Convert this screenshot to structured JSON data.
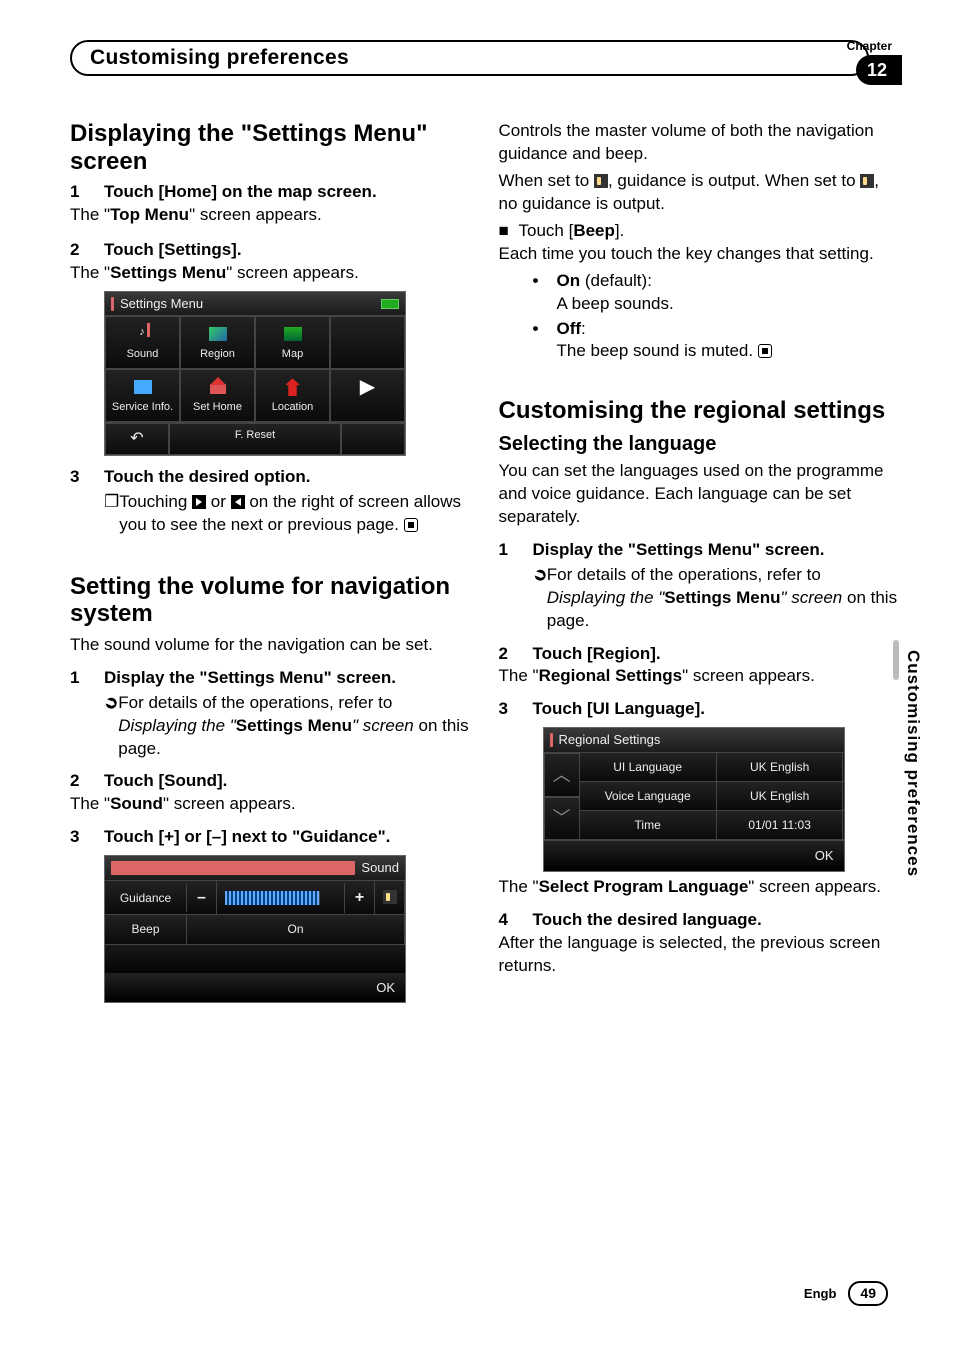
{
  "chapter_label": "Chapter",
  "chapter_number": "12",
  "header_title": "Customising preferences",
  "side_tab": "Customising preferences",
  "footer_lang": "Engb",
  "footer_page": "49",
  "left": {
    "h2_a": "Displaying the \"Settings Menu\" screen",
    "s1_num": "1",
    "s1_label": "Touch [Home] on the map screen.",
    "s1_p_a": "The \"",
    "s1_p_b": "Top Menu",
    "s1_p_c": "\" screen appears.",
    "s2_num": "2",
    "s2_label": "Touch [Settings].",
    "s2_p_a": "The \"",
    "s2_p_b": "Settings Menu",
    "s2_p_c": "\" screen appears.",
    "ss_title": "Settings Menu",
    "ss_items": [
      "Sound",
      "Region",
      "Map",
      "",
      "Service Info.",
      "Set Home",
      "Location",
      ""
    ],
    "ss_reset": "F. Reset",
    "s3_num": "3",
    "s3_label": "Touch the desired option.",
    "s3_sub": " on the right of screen allows you to see the next or previous page.",
    "s3_sub_pre": "Touching ",
    "s3_sub_or": " or ",
    "h2_b": "Setting the volume for navigation system",
    "p_b": "The sound volume for the navigation can be set.",
    "b_s1_num": "1",
    "b_s1_label": "Display the \"Settings Menu\" screen.",
    "b_s1_sub_a": "For details of the operations, refer to ",
    "b_s1_sub_i": "Displaying the \"",
    "b_s1_sub_b": "Settings Menu",
    "b_s1_sub_i2": "\" screen",
    "b_s1_sub_c": " on this page.",
    "b_s2_num": "2",
    "b_s2_label": "Touch [Sound].",
    "b_s2_p_a": "The \"",
    "b_s2_p_b": "Sound",
    "b_s2_p_c": "\" screen appears.",
    "b_s3_num": "3",
    "b_s3_label": "Touch [+] or [–] next to \"Guidance\".",
    "snd_title": "Sound",
    "snd_guidance": "Guidance",
    "snd_beep": "Beep",
    "snd_on": "On",
    "snd_ok": "OK"
  },
  "right": {
    "p1": "Controls the master volume of both the navigation guidance and beep.",
    "p2_a": "When set to ",
    "p2_b": ", guidance is output. When set to ",
    "p2_c": ", no guidance is output.",
    "touch_beep_a": "Touch [",
    "touch_beep_b": "Beep",
    "touch_beep_c": "].",
    "p3": "Each time you touch the key changes that setting.",
    "on_label": "On",
    "on_default": " (default):",
    "on_text": "A beep sounds.",
    "off_label": "Off",
    "off_colon": ":",
    "off_text": "The beep sound is muted.",
    "h2": "Customising the regional settings",
    "h3": "Selecting the language",
    "p4": "You can set the languages used on the programme and voice guidance. Each language can be set separately.",
    "s1_num": "1",
    "s1_label": "Display the \"Settings Menu\" screen.",
    "s1_sub_a": "For details of the operations, refer to ",
    "s1_sub_i": "Displaying the \"",
    "s1_sub_b": "Settings Menu",
    "s1_sub_i2": "\" screen",
    "s1_sub_c": " on this page.",
    "s2_num": "2",
    "s2_label": "Touch [Region].",
    "s2_p_a": "The \"",
    "s2_p_b": "Regional Settings",
    "s2_p_c": "\" screen appears.",
    "s3_num": "3",
    "s3_label": "Touch [UI Language].",
    "reg_title": "Regional Settings",
    "reg_rows": [
      {
        "k": "UI Language",
        "v": "UK English"
      },
      {
        "k": "Voice Language",
        "v": "UK English"
      },
      {
        "k": "Time",
        "v": "01/01 11:03"
      }
    ],
    "reg_ok": "OK",
    "p5_a": "The \"",
    "p5_b": "Select Program Language",
    "p5_c": "\" screen appears.",
    "s4_num": "4",
    "s4_label": "Touch the desired language.",
    "p6": "After the language is selected, the previous screen returns."
  }
}
